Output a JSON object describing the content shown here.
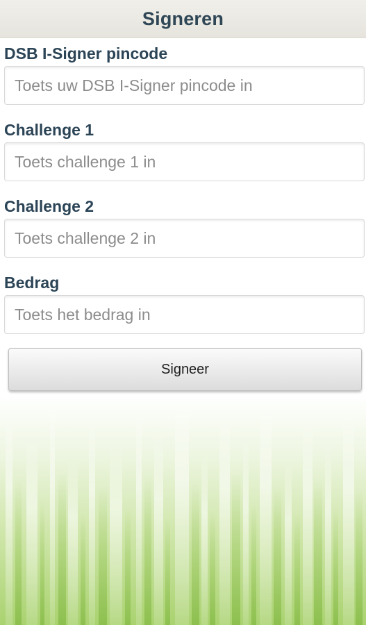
{
  "header": {
    "title": "Signeren"
  },
  "form": {
    "fields": [
      {
        "label": "DSB I-Signer pincode",
        "placeholder": "Toets uw DSB I-Signer pincode in",
        "value": ""
      },
      {
        "label": "Challenge 1",
        "placeholder": "Toets challenge 1 in",
        "value": ""
      },
      {
        "label": "Challenge 2",
        "placeholder": "Toets challenge 2 in",
        "value": ""
      },
      {
        "label": "Bedrag",
        "placeholder": "Toets het bedrag in",
        "value": ""
      }
    ],
    "submit_label": "Signeer"
  },
  "colors": {
    "header_background": "#e8e6df",
    "header_text": "#2f4656",
    "label_text": "#2b4456",
    "placeholder_text": "#8c8c8c",
    "grass_green": "#a9d26f"
  }
}
